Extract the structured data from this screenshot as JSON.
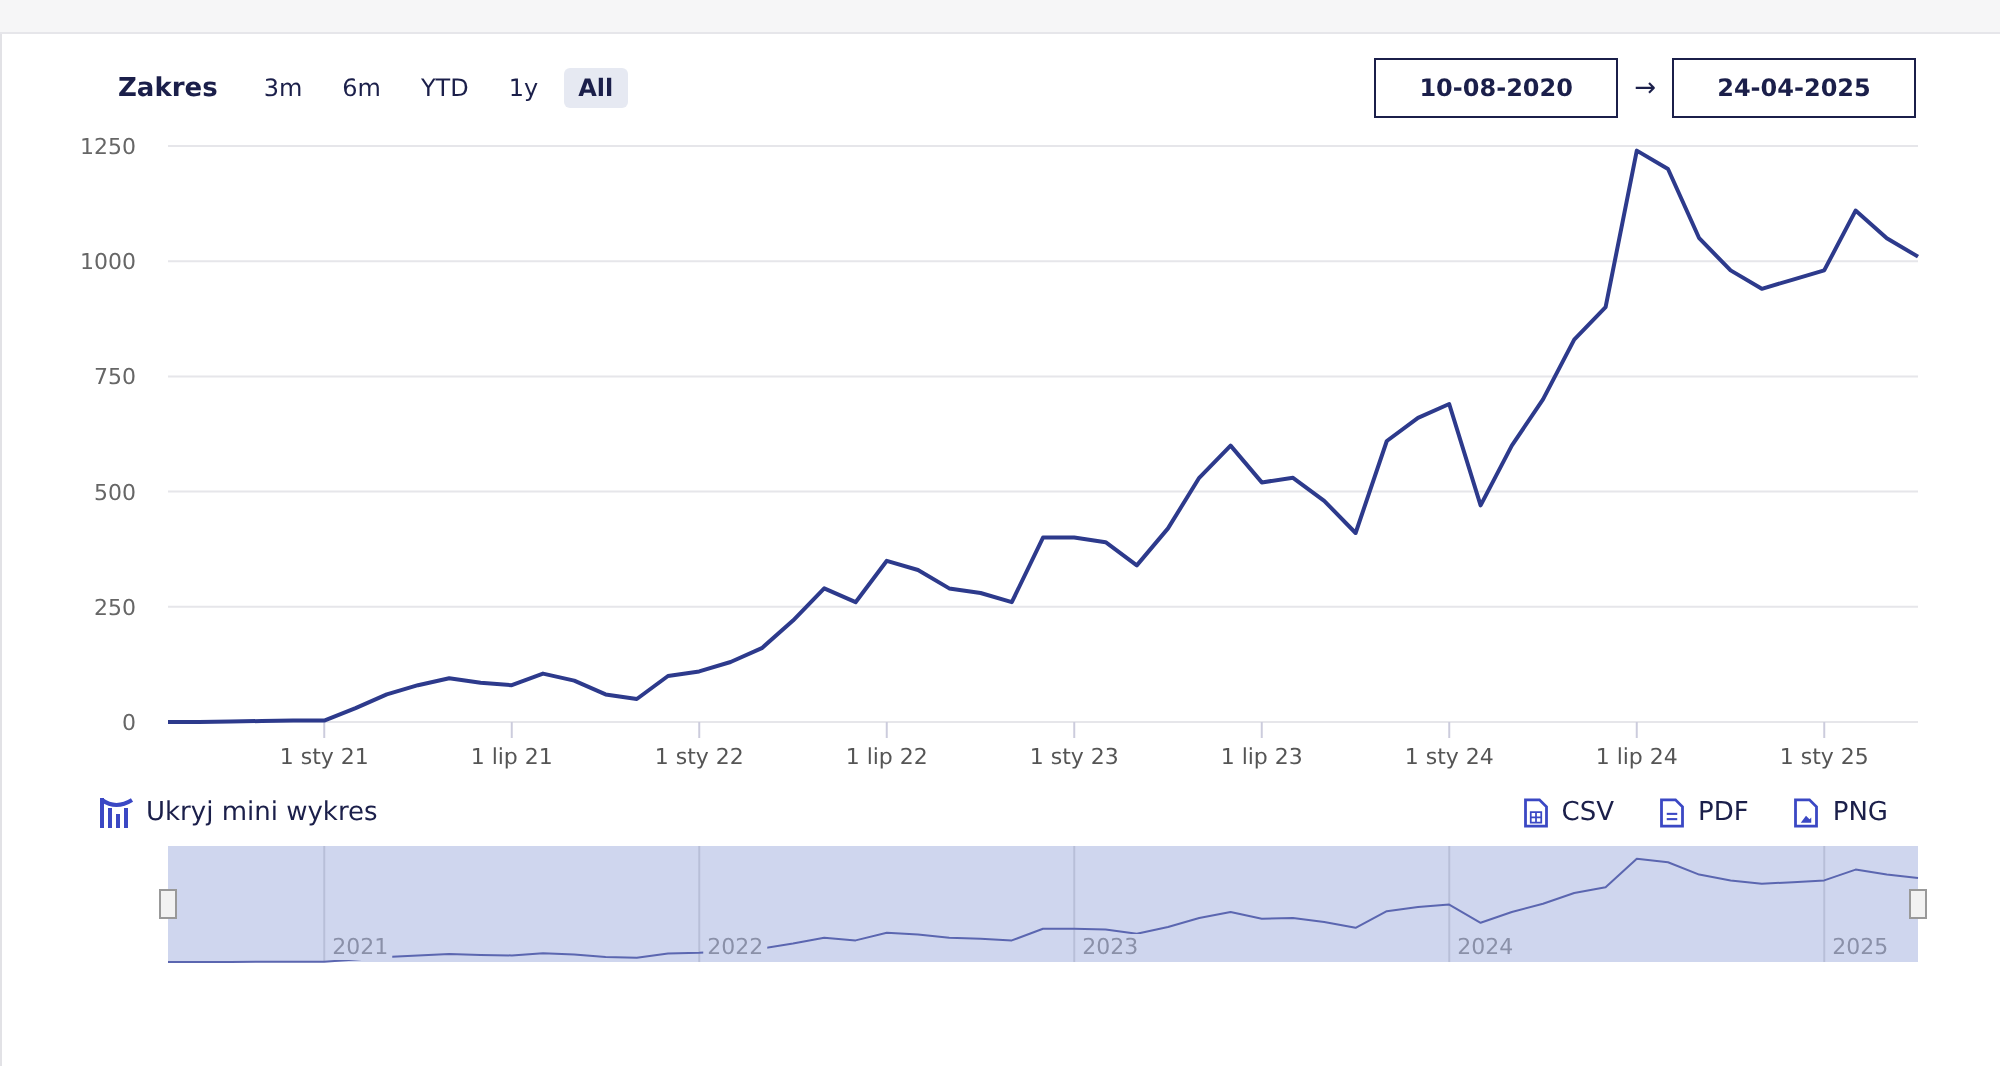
{
  "range_selector": {
    "label": "Zakres",
    "buttons": [
      {
        "label": "3m",
        "selected": false
      },
      {
        "label": "6m",
        "selected": false
      },
      {
        "label": "YTD",
        "selected": false
      },
      {
        "label": "1y",
        "selected": false
      },
      {
        "label": "All",
        "selected": true
      }
    ]
  },
  "date_range": {
    "from": "10-08-2020",
    "separator": "→",
    "to": "24-04-2025"
  },
  "chart_data": {
    "type": "line",
    "categories": [
      null,
      null,
      null,
      null,
      null,
      "1 sty 21",
      null,
      null,
      null,
      null,
      null,
      "1 lip 21",
      null,
      null,
      null,
      null,
      null,
      "1 sty 22",
      null,
      null,
      null,
      null,
      null,
      "1 lip 22",
      null,
      null,
      null,
      null,
      null,
      "1 sty 23",
      null,
      null,
      null,
      null,
      null,
      "1 lip 23",
      null,
      null,
      null,
      null,
      null,
      "1 sty 24",
      null,
      null,
      null,
      null,
      null,
      "1 lip 24",
      null,
      null,
      null,
      null,
      null,
      "1 sty 25",
      null,
      null,
      null
    ],
    "series": [
      {
        "color": "#2d3a8c",
        "values": [
          0,
          0,
          1,
          2,
          3,
          3,
          30,
          60,
          80,
          95,
          85,
          80,
          105,
          90,
          60,
          50,
          100,
          110,
          130,
          160,
          220,
          290,
          260,
          350,
          330,
          290,
          280,
          260,
          400,
          400,
          390,
          340,
          420,
          530,
          600,
          520,
          530,
          480,
          410,
          610,
          660,
          690,
          470,
          600,
          700,
          830,
          900,
          1240,
          1200,
          1050,
          980,
          940,
          960,
          980,
          1110,
          1050,
          1010
        ]
      }
    ],
    "ylim": [
      0,
      1250
    ],
    "grid": true,
    "yticks": [
      0,
      250,
      500,
      750,
      1000,
      1250
    ]
  },
  "mini_chart_toggle": {
    "label": "Ukryj mini wykres"
  },
  "exports": [
    {
      "kind": "csv",
      "label": "CSV"
    },
    {
      "kind": "pdf",
      "label": "PDF"
    },
    {
      "kind": "png",
      "label": "PNG"
    }
  ],
  "navigator": {
    "labels": [
      "2021",
      "2022",
      "2023",
      "2024",
      "2025"
    ]
  }
}
